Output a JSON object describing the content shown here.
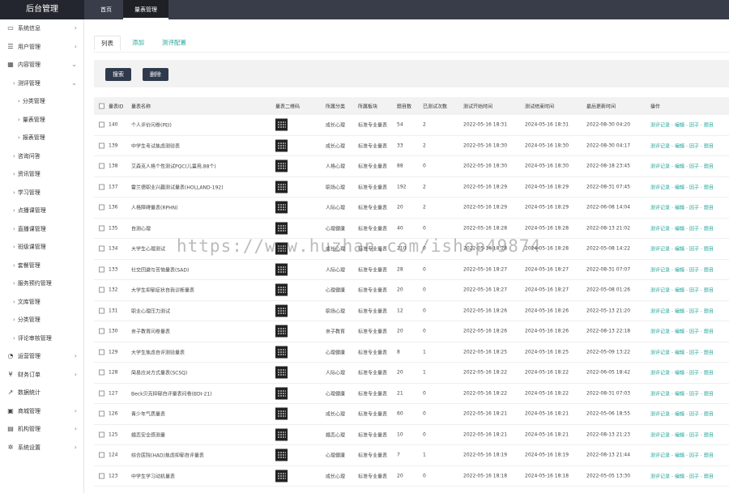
{
  "app": {
    "title": "后台管理"
  },
  "topnav": [
    {
      "label": "首页",
      "active": false
    },
    {
      "label": "量表管理",
      "active": true
    }
  ],
  "sidebar": [
    {
      "label": "系统信息",
      "icon": "monitor-icon",
      "glyph": "▭",
      "arrow": "›",
      "level": 0
    },
    {
      "label": "用户管理",
      "icon": "users-icon",
      "glyph": "☰",
      "arrow": "›",
      "level": 0
    },
    {
      "label": "内容管理",
      "icon": "grid-icon",
      "glyph": "▦",
      "arrow": "⌄",
      "level": 0
    },
    {
      "label": "测评管理",
      "level": 1,
      "arrow": "⌄"
    },
    {
      "label": "分类管理",
      "level": 2
    },
    {
      "label": "量表管理",
      "level": 2
    },
    {
      "label": "报表管理",
      "level": 2
    },
    {
      "label": "咨询问答",
      "level": 1
    },
    {
      "label": "资讯管理",
      "level": 1
    },
    {
      "label": "学习管理",
      "level": 1
    },
    {
      "label": "点播课管理",
      "level": 1
    },
    {
      "label": "直播课管理",
      "level": 1
    },
    {
      "label": "班级课管理",
      "level": 1
    },
    {
      "label": "套餐管理",
      "level": 1
    },
    {
      "label": "服务预约管理",
      "level": 1
    },
    {
      "label": "文库管理",
      "level": 1
    },
    {
      "label": "分类管理",
      "level": 1
    },
    {
      "label": "评论审核管理",
      "level": 1
    },
    {
      "label": "运营管理",
      "icon": "chart-icon",
      "glyph": "◔",
      "arrow": "›",
      "level": 0
    },
    {
      "label": "财务订单",
      "icon": "yen-icon",
      "glyph": "¥",
      "arrow": "›",
      "level": 0
    },
    {
      "label": "数据统计",
      "icon": "stats-icon",
      "glyph": "↗",
      "arrow": "",
      "level": 0
    },
    {
      "label": "商城管理",
      "icon": "shop-icon",
      "glyph": "▣",
      "arrow": "›",
      "level": 0
    },
    {
      "label": "机构管理",
      "icon": "building-icon",
      "glyph": "▤",
      "arrow": "›",
      "level": 0
    },
    {
      "label": "系统设置",
      "icon": "gear-icon",
      "glyph": "✲",
      "arrow": "›",
      "level": 0
    }
  ],
  "tabs": [
    {
      "label": "列表",
      "active": true
    },
    {
      "label": "添加",
      "active": false
    },
    {
      "label": "测评配置",
      "active": false
    }
  ],
  "toolbar": {
    "search": "搜索",
    "delete": "删除"
  },
  "table": {
    "headers": [
      "量表ID",
      "量表名称",
      "量表二维码",
      "所属分类",
      "所属板块",
      "题目数",
      "已测试次数",
      "测试开始时间",
      "测试结束时间",
      "最后更新时间",
      "操作"
    ],
    "ops": [
      "测评记录",
      "编辑",
      "因子",
      "题目"
    ],
    "rows": [
      [
        "140",
        "个人评价问卷(PEI)",
        "成长心理",
        "标准专业量表",
        "54",
        "2",
        "2022-05-16 18:31",
        "2024-05-16 18:31",
        "2022-08-30 04:20"
      ],
      [
        "139",
        "中学生考试焦虑测验表",
        "成长心理",
        "标准专业量表",
        "33",
        "2",
        "2022-05-16 18:30",
        "2024-05-16 18:30",
        "2022-08-30 04:17"
      ],
      [
        "138",
        "艾森克人格个性测试PQC(儿童用,88个)",
        "人格心理",
        "标准专业量表",
        "88",
        "0",
        "2022-05-16 18:30",
        "2024-05-16 18:30",
        "2022-08-18 23:45"
      ],
      [
        "137",
        "霍兰德职业兴趣测试量表(HOLLAND-192)",
        "职场心理",
        "标准专业量表",
        "192",
        "2",
        "2022-05-16 18:29",
        "2024-05-16 18:29",
        "2022-08-31 07:45"
      ],
      [
        "136",
        "人格障碍量表(RPHN)",
        "人际心理",
        "标准专业量表",
        "20",
        "2",
        "2022-05-16 18:29",
        "2024-05-16 18:29",
        "2022-06-08 14:04"
      ],
      [
        "135",
        "自测心理",
        "心理健康",
        "标准专业量表",
        "40",
        "0",
        "2022-05-16 18:28",
        "2024-05-16 18:28",
        "2022-08-13 21:02"
      ],
      [
        "134",
        "大学生心理测试",
        "成长心理",
        "标准专业量表",
        "210",
        "0",
        "2022-05-16 18:28",
        "2024-05-16 18:28",
        "2022-05-08 14:22"
      ],
      [
        "133",
        "社交回避与苦恼量表(SAD)",
        "人际心理",
        "标准专业量表",
        "28",
        "0",
        "2022-05-16 18:27",
        "2024-05-16 18:27",
        "2022-08-31 07:07"
      ],
      [
        "132",
        "大学生抑郁症状自我诊断量表",
        "心理健康",
        "标准专业量表",
        "20",
        "0",
        "2022-05-16 18:27",
        "2024-05-16 18:27",
        "2022-05-08 01:26"
      ],
      [
        "131",
        "职业心理压力测试",
        "职场心理",
        "标准专业量表",
        "12",
        "0",
        "2022-05-16 18:26",
        "2024-05-16 18:26",
        "2022-05-13 21:20"
      ],
      [
        "130",
        "亲子教育问卷量表",
        "亲子教育",
        "标准专业量表",
        "20",
        "0",
        "2022-05-16 18:26",
        "2024-05-16 18:26",
        "2022-08-13 22:18"
      ],
      [
        "129",
        "大学生焦虑自评测验量表",
        "心理健康",
        "标准专业量表",
        "8",
        "1",
        "2022-05-16 18:25",
        "2024-05-16 18:25",
        "2022-05-09 13:22"
      ],
      [
        "128",
        "简易应对方式量表(SCSQ)",
        "人际心理",
        "标准专业量表",
        "20",
        "1",
        "2022-05-16 18:22",
        "2024-05-16 18:22",
        "2022-06-05 18:42"
      ],
      [
        "127",
        "Beck贝克抑郁自评量表问卷(BDI-21)",
        "心理健康",
        "标准专业量表",
        "21",
        "0",
        "2022-05-16 18:22",
        "2024-05-16 18:22",
        "2022-08-31 07:03"
      ],
      [
        "126",
        "青少年气质量表",
        "成长心理",
        "标准专业量表",
        "60",
        "0",
        "2022-05-16 18:21",
        "2024-05-16 18:21",
        "2022-05-06 18:55"
      ],
      [
        "125",
        "婚恋安全感测量",
        "婚恋心理",
        "标准专业量表",
        "10",
        "0",
        "2022-05-16 18:21",
        "2024-05-16 18:21",
        "2022-08-13 21:23"
      ],
      [
        "124",
        "综合医院(HAD)焦虑抑郁自评量表",
        "心理健康",
        "标准专业量表",
        "7",
        "1",
        "2022-05-16 18:19",
        "2024-05-16 18:19",
        "2022-08-13 21:44"
      ],
      [
        "123",
        "中学生学习动机量表",
        "成长心理",
        "标准专业量表",
        "20",
        "0",
        "2022-05-16 18:18",
        "2024-05-16 18:18",
        "2022-05-05 13:30"
      ]
    ]
  },
  "watermark": "https://www.huzhan.com/ishop49874"
}
